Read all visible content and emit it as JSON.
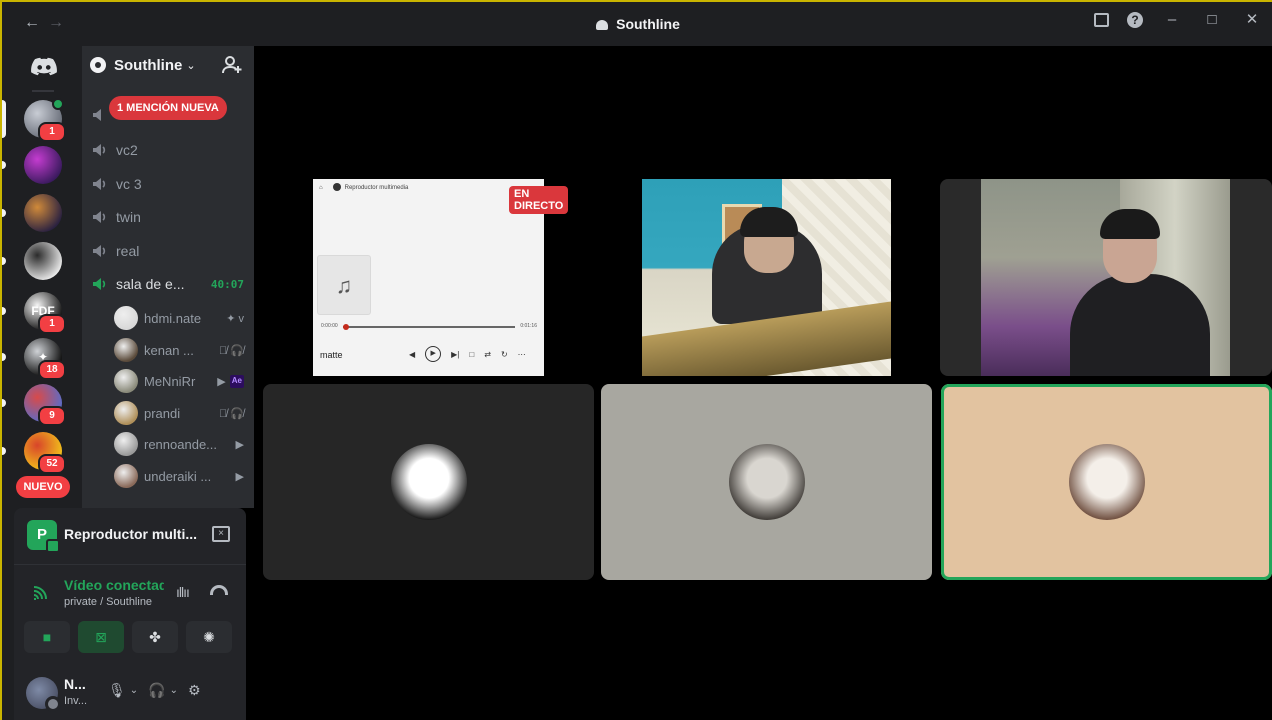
{
  "window": {
    "title": "Southline",
    "back_glyph": "←",
    "forward_glyph": "→"
  },
  "servers": [
    {
      "badge": "1",
      "colors": [
        "#6a6f7a",
        "#c8ccd4"
      ],
      "active": true,
      "has_dot": true
    },
    {
      "badge": "",
      "colors": [
        "#3a1a5e",
        "#c43cd0"
      ]
    },
    {
      "badge": "",
      "colors": [
        "#2a2140",
        "#d08a3a"
      ]
    },
    {
      "badge": "",
      "colors": [
        "#e8e8e8",
        "#2b2b2b"
      ]
    },
    {
      "badge": "1",
      "colors": [
        "#141414",
        "#f4f4f4"
      ],
      "text": "FDF"
    },
    {
      "badge": "18",
      "colors": [
        "#0d0d0d",
        "#cfd2d6"
      ],
      "text": "✦"
    },
    {
      "badge": "9",
      "colors": [
        "#5a6cc8",
        "#d84a4a"
      ]
    },
    {
      "badge": "52",
      "colors": [
        "#f2c21b",
        "#d8452a"
      ]
    }
  ],
  "rail": {
    "nuevo_label": "NUEVO"
  },
  "guild": {
    "name": "Southline",
    "mention_label": "1 MENCIÓN NUEVA"
  },
  "channels": [
    {
      "name": "vc2"
    },
    {
      "name": "vc 3"
    },
    {
      "name": "twin"
    },
    {
      "name": "real"
    },
    {
      "name": "sala de e...",
      "timer": "40:07",
      "active": true
    }
  ],
  "members": [
    {
      "name": "hdmi.nate",
      "icons": "✦ v",
      "color": "#d8d8d8"
    },
    {
      "name": "kenan ...",
      "icons": "🎙̸ 🎧̸",
      "color": "#5a4a3a"
    },
    {
      "name": "MeNniRr",
      "icons": "▶",
      "ae": "Ae",
      "color": "#8a8a7a"
    },
    {
      "name": "prandi",
      "icons": "🎙̸ 🎧̸",
      "color": "#b0905a"
    },
    {
      "name": "rennoande...",
      "icons": "▶",
      "color": "#9a9a9a"
    },
    {
      "name": "underaiki ...",
      "icons": "▶",
      "color": "#8a6a5a"
    }
  ],
  "activity": {
    "app_letter": "P",
    "app_name": "Reproductor multi...",
    "close_glyph": "×"
  },
  "voice": {
    "title": "Vídeo conectad",
    "subtitle": "private / Southline"
  },
  "voice_buttons": [
    {
      "name": "camera-button",
      "glyph": "■",
      "style": "green"
    },
    {
      "name": "screen-share-button",
      "glyph": "⊠",
      "style": "sharing"
    },
    {
      "name": "activities-button",
      "glyph": "✤",
      "style": ""
    },
    {
      "name": "soundboard-button",
      "glyph": "✺",
      "style": ""
    }
  ],
  "user": {
    "name": "N...",
    "status": "Inv..."
  },
  "stream": {
    "live_label": "EN DIRECTO",
    "player_title": "Reproductor multimedia",
    "time_start": "0:00:00",
    "time_end": "0:01:16",
    "track_name": "matte",
    "note_glyph": "♫"
  },
  "tiles": [
    {
      "name": "participant-avatar-1",
      "bg": "#262626",
      "avatar": [
        "#ffffff",
        "#111111"
      ]
    },
    {
      "name": "participant-avatar-2",
      "bg": "#a8a7a0",
      "avatar": [
        "#d9d6d0",
        "#3a3632"
      ]
    },
    {
      "name": "participant-avatar-3",
      "bg": "#e2c3a0",
      "avatar": [
        "#f4efe9",
        "#6b4a3a"
      ],
      "speaking": true
    }
  ],
  "colors": {
    "speaking": "#23a55a",
    "live": "#da373c",
    "brand": "#5865f2"
  }
}
